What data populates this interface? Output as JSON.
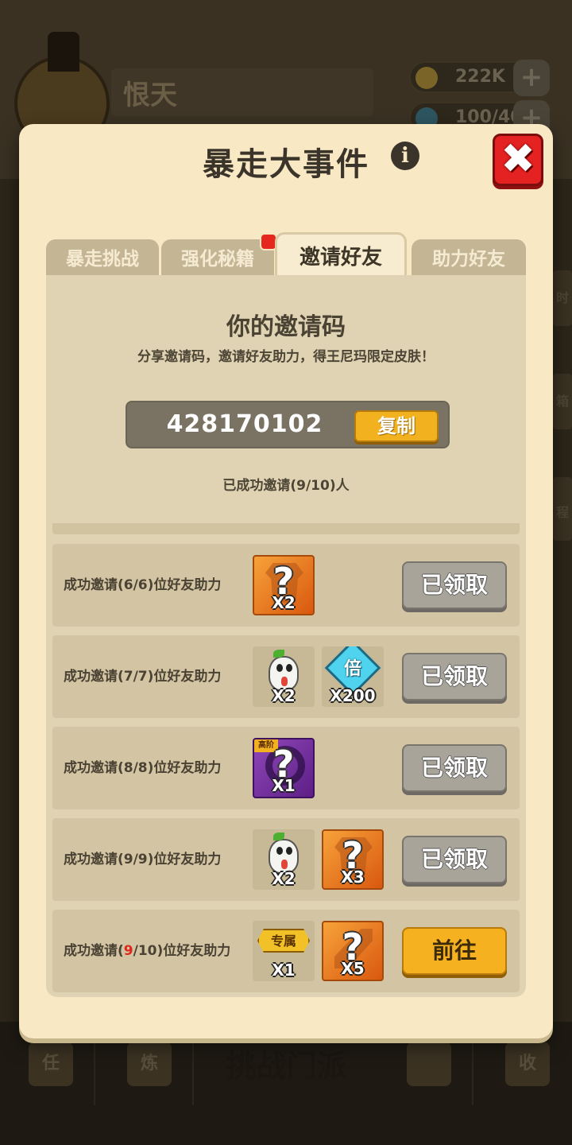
{
  "background": {
    "player_name": "恨天",
    "coins": "222K",
    "stamina": "100/40",
    "bottom_nav": {
      "item1": "任",
      "item2": "炼",
      "main": "挑战门派",
      "item4": "",
      "item5": "收"
    },
    "side_labels": [
      "时",
      "箱",
      "神",
      "程"
    ]
  },
  "dialog": {
    "title": "暴走大事件",
    "tabs": [
      {
        "label": "暴走挑战"
      },
      {
        "label": "强化秘籍"
      },
      {
        "label": "邀请好友"
      },
      {
        "label": "助力好友"
      }
    ],
    "active_tab": 2,
    "invite": {
      "heading": "你的邀请码",
      "description": "分享邀请码，邀请好友助力，得王尼玛限定皮肤！",
      "code": "428170102",
      "copy_label": "复制",
      "count_text": "已成功邀请(9/10)人"
    },
    "rows": [
      {
        "label": "成功邀请(6/6)位好友助力",
        "items": [
          {
            "icon": "mystery-shirt-icon",
            "qty": "X2"
          }
        ],
        "button": "已领取",
        "claimed": true
      },
      {
        "label": "成功邀请(7/7)位好友助力",
        "items": [
          {
            "icon": "radish-face-icon",
            "qty": "X2"
          },
          {
            "icon": "multiplier-diamond-icon",
            "symbol": "倍",
            "qty": "X200"
          }
        ],
        "button": "已领取",
        "claimed": true
      },
      {
        "label": "成功邀请(8/8)位好友助力",
        "items": [
          {
            "icon": "mystery-ring-icon",
            "tag": "高阶",
            "qty": "X1"
          }
        ],
        "button": "已领取",
        "claimed": true
      },
      {
        "label": "成功邀请(9/9)位好友助力",
        "items": [
          {
            "icon": "radish-face-icon",
            "qty": "X2"
          },
          {
            "icon": "mystery-shirt-icon",
            "qty": "X3"
          }
        ],
        "button": "已领取",
        "claimed": true
      },
      {
        "label_prefix": "成功邀请(",
        "label_highlight": "9",
        "label_suffix": "/10)位好友助力",
        "items": [
          {
            "icon": "exclusive-badge-icon",
            "symbol": "专属",
            "qty": "X1"
          },
          {
            "icon": "mystery-weapon-icon",
            "qty": "X5"
          }
        ],
        "button": "前往",
        "claimed": false
      }
    ]
  },
  "colors": {
    "dialog_bg": "#f8e8c3",
    "panel_bg": "#e0d3b3",
    "row_bg": "#d3c4a3",
    "claimed_button": "#a9a49a",
    "go_button": "#f5b120",
    "close_button": "#e42222",
    "highlight": "#e0271c"
  }
}
